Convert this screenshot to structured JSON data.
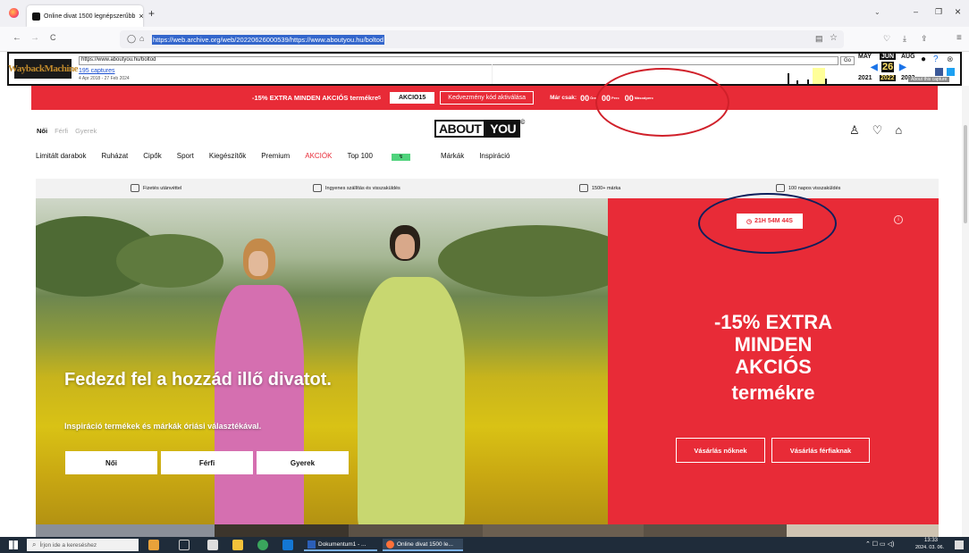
{
  "browser": {
    "tab_title": "Online divat 1500 legnépszerűbb",
    "tab_close": "×",
    "new_tab": "+",
    "back": "←",
    "forward": "→",
    "reload": "C",
    "url": "https://web.archive.org/web/20220626000539/https://www.aboutyou.hu/boltod",
    "win_min": "–",
    "win_max": "❐",
    "win_close": "×"
  },
  "wayback": {
    "logo": "WaybackMachine",
    "url_value": "https://www.aboutyou.hu/boltod",
    "go": "Go",
    "captures": "195 captures",
    "range": "4 Apr 2018 - 27 Feb 2024",
    "months": [
      "MAY",
      "JUN",
      "AUG"
    ],
    "day": "26",
    "years": [
      "2021",
      "2022",
      "2023"
    ],
    "about": "About this capture"
  },
  "promo": {
    "text": "-15% EXTRA MINDEN AKCIÓS termékre",
    "sup": "5",
    "code": "AKCIO15",
    "activate": "Kedvezmény kód aktiválása",
    "countdown_label": "Már csak:",
    "h": "00",
    "h_unit": "Óra",
    "m": "00",
    "m_unit": "Perc",
    "s": "00",
    "s_unit": "Másodperc"
  },
  "header": {
    "genders": [
      "Női",
      "Férfi",
      "Gyerek"
    ],
    "logo_a": "ABOUT",
    "logo_b": "YOU",
    "logo_mark": "©",
    "categories": [
      "Limitált darabok",
      "Ruházat",
      "Cipők",
      "Sport",
      "Kiegészítők",
      "Premium",
      "AKCIÓK",
      "Top 100",
      "Márkák",
      "Inspiráció"
    ],
    "top100_badge": "↯"
  },
  "usp": [
    "Fizetés utánvéttel",
    "Ingyenes szállítás és visszaküldés",
    "1500+ márka",
    "100 napos visszaküldés"
  ],
  "hero": {
    "title": "Fedezd fel a hozzád illő divatot.",
    "subtitle": "Inspiráció termékek és márkák óriási választékával.",
    "buttons": [
      "Női",
      "Férfi",
      "Gyerek"
    ]
  },
  "sale": {
    "timer": "21H 54M 44S",
    "info": "i",
    "line1": "-15% EXTRA",
    "line2": "MINDEN",
    "line3": "AKCIÓS",
    "line4": "termékre",
    "btn_women": "Vásárlás nőknek",
    "btn_men": "Vásárlás férfiaknak"
  },
  "taskbar": {
    "search": "Írjon ide a kereséshez",
    "app_word": "Dokumentum1 - ...",
    "app_browser": "Online divat 1500 le...",
    "time": "13:33",
    "date": "2024. 03. 06."
  },
  "colors": {
    "brand_red": "#e82b37",
    "annotation_red": "#d0202a",
    "annotation_navy": "#0d1f5c"
  }
}
